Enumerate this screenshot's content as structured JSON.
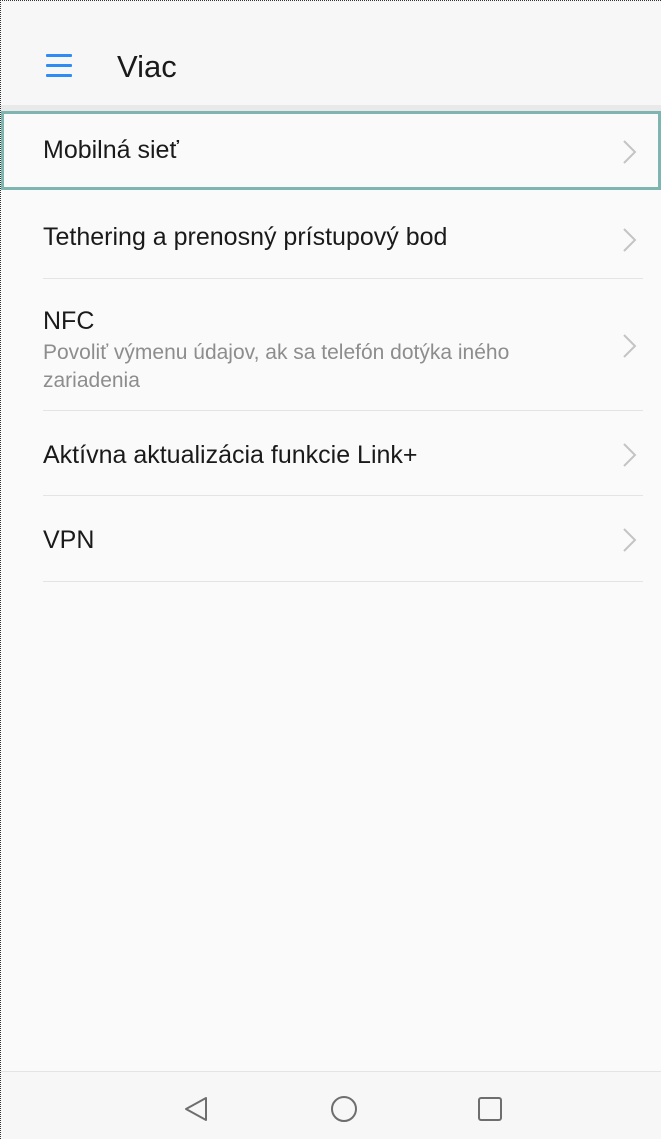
{
  "header": {
    "title": "Viac",
    "menu_icon": "hamburger-menu-icon",
    "accent_color": "#2f8cf4"
  },
  "settings": [
    {
      "title": "Mobilná sieť",
      "subtitle": null,
      "focused": true
    },
    {
      "title": "Tethering a prenosný prístupový bod",
      "subtitle": null
    },
    {
      "title": "NFC",
      "subtitle": "Povoliť výmenu údajov, ak sa telefón dotýka iného zariadenia"
    },
    {
      "title": "Aktívna aktualizácia funkcie Link+",
      "subtitle": null
    },
    {
      "title": "VPN",
      "subtitle": null
    }
  ],
  "navbar": {
    "buttons": [
      "back-triangle-icon",
      "home-circle-icon",
      "recents-square-icon"
    ]
  }
}
